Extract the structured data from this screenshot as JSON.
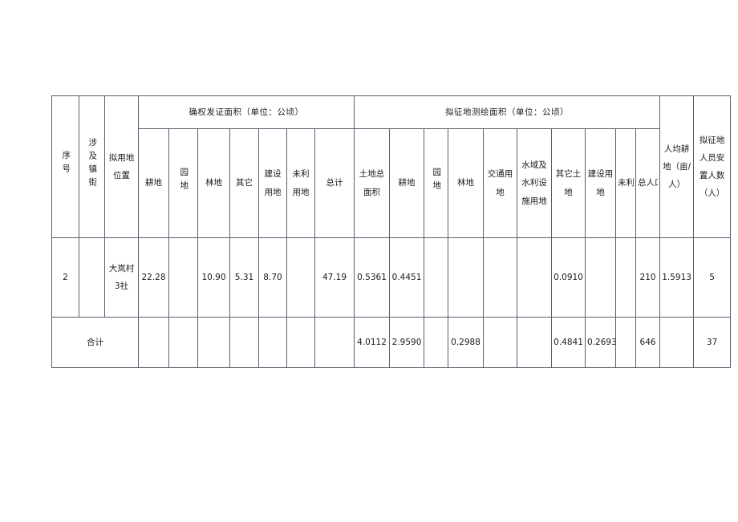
{
  "table": {
    "group_headers": {
      "col_seq": "序号",
      "col_town": "涉及镇街",
      "col_location": "拟用地位置",
      "group1": "确权发证面积（单位：公顷）",
      "group2": "拟征地测绘面积（单位：公顷）",
      "col_population": "总人口",
      "col_percapita": "人均耕地（亩/人）",
      "col_resettle": "拟征地人员安置人数（人）"
    },
    "group1_subheaders": [
      "耕地",
      "园地",
      "林地",
      "其它",
      "建设用地",
      "未利用地",
      "总计"
    ],
    "group2_subheaders": [
      "土地总面积",
      "耕地",
      "园地",
      "林地",
      "交通用地",
      "水域及水利设施用地",
      "其它土地",
      "建设用地",
      "未利用地"
    ],
    "rows": [
      {
        "seq": "2",
        "town": "",
        "location": "大岚村3社",
        "g1_farm": "22.28",
        "g1_garden": "",
        "g1_forest": "10.90",
        "g1_other": "5.31",
        "g1_construction": "8.70",
        "g1_unused": "",
        "g1_total": "47.19",
        "g2_total_area": "0.5361",
        "g2_farm": "0.4451",
        "g2_garden": "",
        "g2_forest": "",
        "g2_transport": "",
        "g2_water": "",
        "g2_other_land": "0.0910",
        "g2_construction": "",
        "g2_unused": "",
        "population": "210",
        "per_capita": "1.5913",
        "resettle": "5"
      }
    ],
    "total_row": {
      "label": "合计",
      "g1_farm": "",
      "g1_garden": "",
      "g1_forest": "",
      "g1_other": "",
      "g1_construction": "",
      "g1_unused": "",
      "g1_total": "",
      "g2_total_area": "4.0112",
      "g2_farm": "2.9590",
      "g2_garden": "",
      "g2_forest": "0.2988",
      "g2_transport": "",
      "g2_water": "",
      "g2_other_land": "0.4841",
      "g2_construction": "0.2693",
      "g2_unused": "",
      "population": "646",
      "per_capita": "",
      "resettle": "37"
    }
  }
}
